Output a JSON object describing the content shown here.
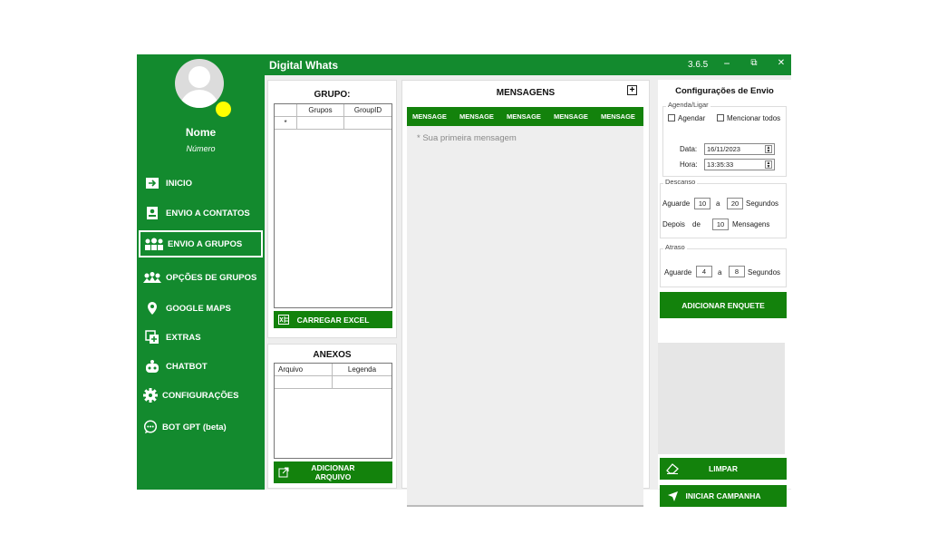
{
  "window": {
    "title": "Digital Whats",
    "version": "3.6.5",
    "minimize": "−",
    "restore": "⧉",
    "close": "✕"
  },
  "profile": {
    "name": "Nome",
    "number": "Número"
  },
  "nav": [
    {
      "label": "INICIO",
      "icon": "arrow-right-icon"
    },
    {
      "label": "ENVIO A CONTATOS",
      "icon": "contact-card-icon"
    },
    {
      "label": "ENVIO A GRUPOS",
      "icon": "group-icon"
    },
    {
      "label": "OPÇÕES DE GRUPOS",
      "icon": "group-settings-icon"
    },
    {
      "label": "GOOGLE MAPS",
      "icon": "map-pin-icon"
    },
    {
      "label": "EXTRAS",
      "icon": "add-layers-icon"
    },
    {
      "label": "CHATBOT",
      "icon": "robot-icon"
    },
    {
      "label": "CONFIGURAÇÕES",
      "icon": "gear-icon"
    },
    {
      "label": "BOT GPT (beta)",
      "icon": "chat-bubble-icon"
    }
  ],
  "group_panel": {
    "title": "GRUPO:",
    "columns": [
      "Grupos",
      "GroupID"
    ],
    "row_marker": "*",
    "button": "CARREGAR EXCEL"
  },
  "attach_panel": {
    "title": "ANEXOS",
    "columns": [
      "Arquivo",
      "Legenda"
    ],
    "button": "ADICIONAR ARQUIVO"
  },
  "messages": {
    "title": "MENSAGENS",
    "add": "+",
    "tabs": [
      "MENSAGE",
      "MENSAGE",
      "MENSAGE",
      "MENSAGE",
      "MENSAGE"
    ],
    "placeholder": "* Sua primeira mensagem"
  },
  "config": {
    "title": "Configurações de Envio",
    "agenda": {
      "legend": "Agenda/Ligar",
      "schedule": "Agendar",
      "mention": "Mencionar todos",
      "date_label": "Data:",
      "date": "16/11/2023",
      "time_label": "Hora:",
      "time": "13:35:33"
    },
    "descanso": {
      "legend": "Descanso",
      "aguarde": "Aguarde",
      "from": "10",
      "a": "a",
      "to": "20",
      "segundos": "Segundos",
      "depois": "Depois",
      "de": "de",
      "count": "10",
      "mensagens": "Mensagens"
    },
    "atraso": {
      "legend": "Atraso",
      "aguarde": "Aguarde",
      "from": "4",
      "a": "a",
      "to": "8",
      "segundos": "Segundos"
    },
    "poll_button": "ADICIONAR ENQUETE",
    "clear_button": "LIMPAR",
    "start_button": "INICIAR CAMPANHA"
  },
  "colors": {
    "brand": "#138a2e",
    "button": "#13820c",
    "status_dot": "#ffff00"
  }
}
